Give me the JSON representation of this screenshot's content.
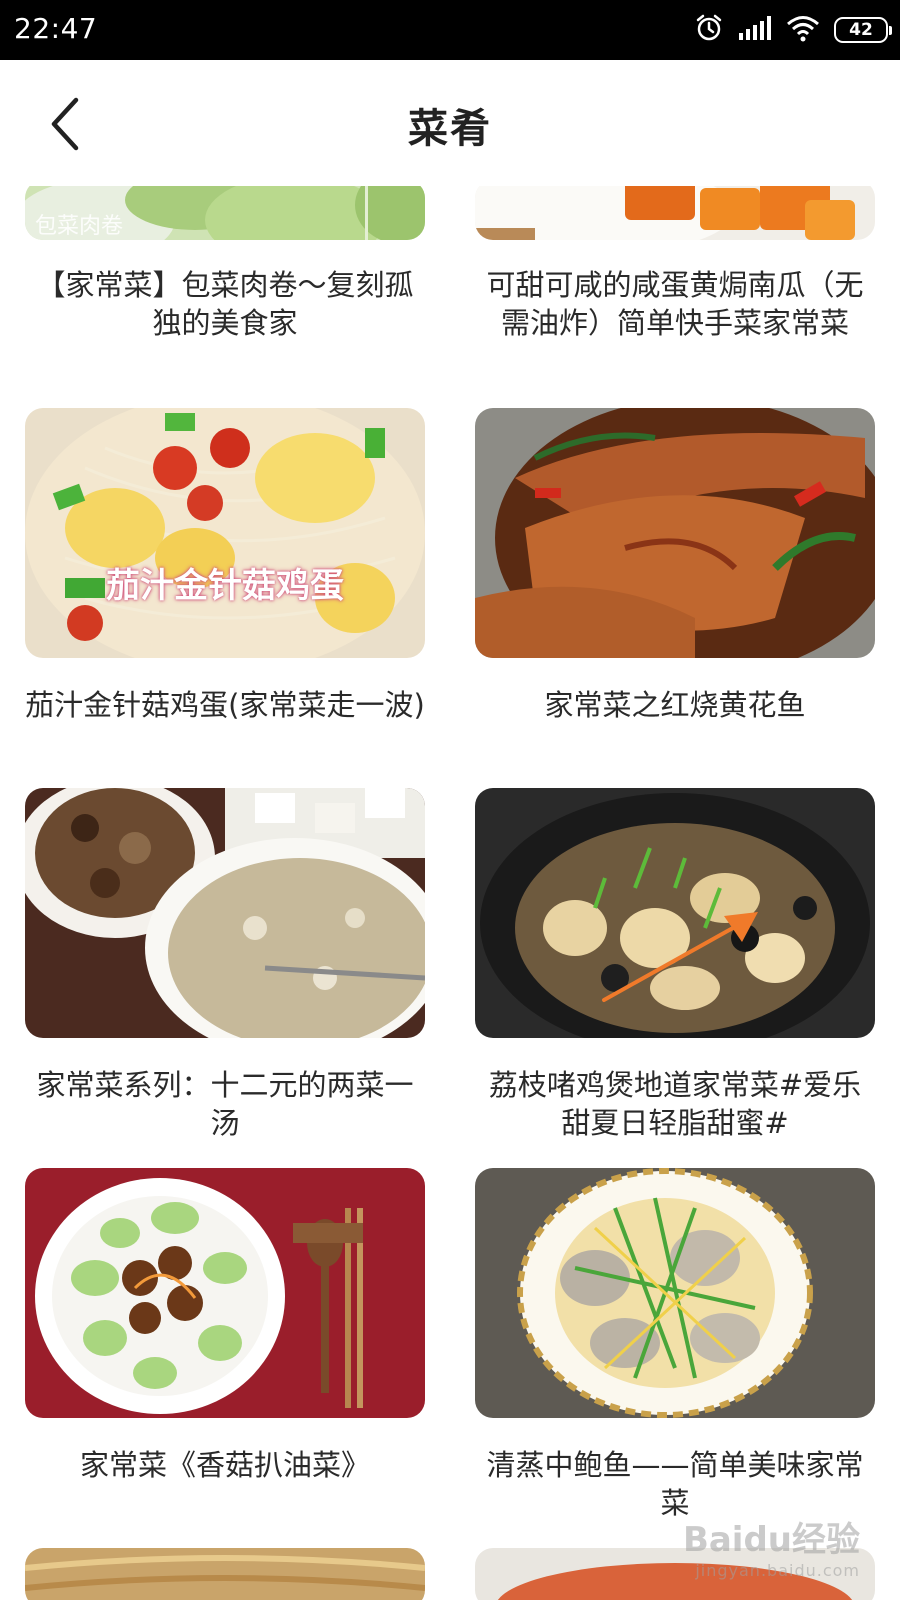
{
  "status_bar": {
    "time": "22:47",
    "battery": "42",
    "icons": [
      "alarm-icon",
      "signal-icon",
      "wifi-icon",
      "battery-icon"
    ]
  },
  "header": {
    "title": "菜肴",
    "back_icon": "chevron-left-icon"
  },
  "cards": [
    {
      "title": "【家常菜】包菜肉卷～复刻孤独的美食家",
      "image_text": "包菜肉卷"
    },
    {
      "title": "可甜可咸的咸蛋黄焗南瓜（无需油炸）简单快手菜家常菜"
    },
    {
      "title": "茄汁金针菇鸡蛋(家常菜走一波)",
      "image_text": "茄汁金针菇鸡蛋"
    },
    {
      "title": "家常菜之红烧黄花鱼"
    },
    {
      "title": "家常菜系列：十二元的两菜一汤"
    },
    {
      "title": "荔枝啫鸡煲地道家常菜#爱乐甜夏日轻脂甜蜜#"
    },
    {
      "title": "家常菜《香菇扒油菜》"
    },
    {
      "title": "清蒸中鲍鱼——简单美味家常菜"
    }
  ],
  "annotation": {
    "color": "#f07a2a"
  },
  "watermark": {
    "brand": "Baidu经验",
    "url": "jingyan.baidu.com"
  },
  "colors": {
    "status_bar_bg": "#000000",
    "background": "#ffffff",
    "title_text": "#222222"
  }
}
